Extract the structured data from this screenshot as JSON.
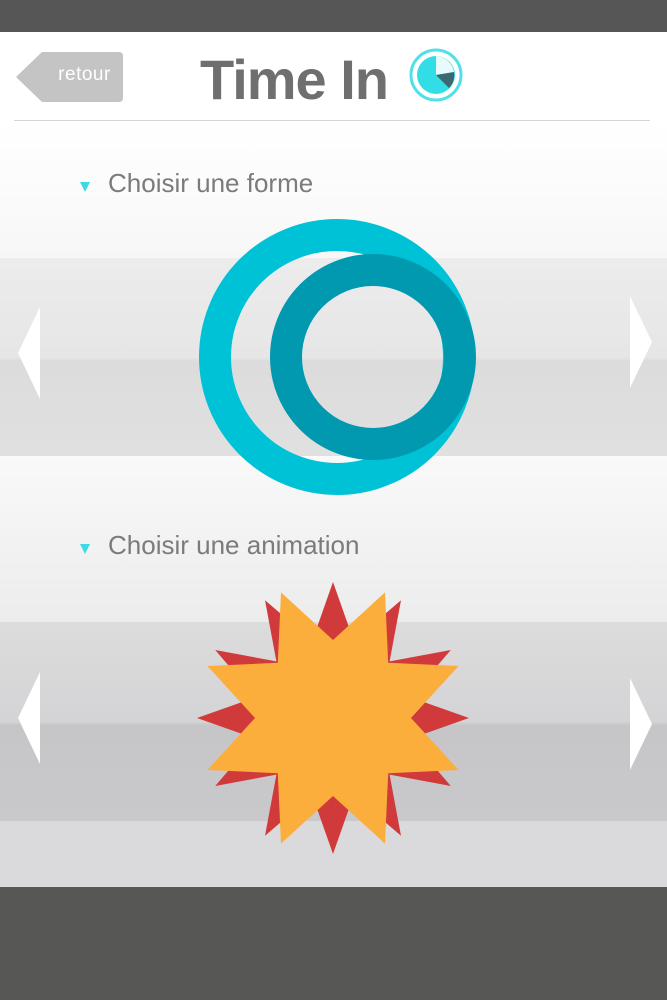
{
  "header": {
    "back_label": "retour",
    "title": "Time In",
    "title_icon": "timer-clock-icon"
  },
  "sections": [
    {
      "heading": "Choisir une forme",
      "preview_icon": "concentric-rings-icon",
      "prev_icon": "chevron-left-icon",
      "next_icon": "chevron-right-icon"
    },
    {
      "heading": "Choisir une animation",
      "preview_icon": "starburst-icon",
      "prev_icon": "chevron-left-icon",
      "next_icon": "chevron-right-icon"
    }
  ],
  "colors": {
    "accent": "#00bcd4",
    "ring_outer": "#00c2d6",
    "ring_inner": "#0099b0",
    "star_back": "#d13a3a",
    "star_front": "#fbae3c",
    "heading_text": "#7b7b7b",
    "title_text": "#6f6f6f",
    "back_button": "#c4c4c4"
  }
}
